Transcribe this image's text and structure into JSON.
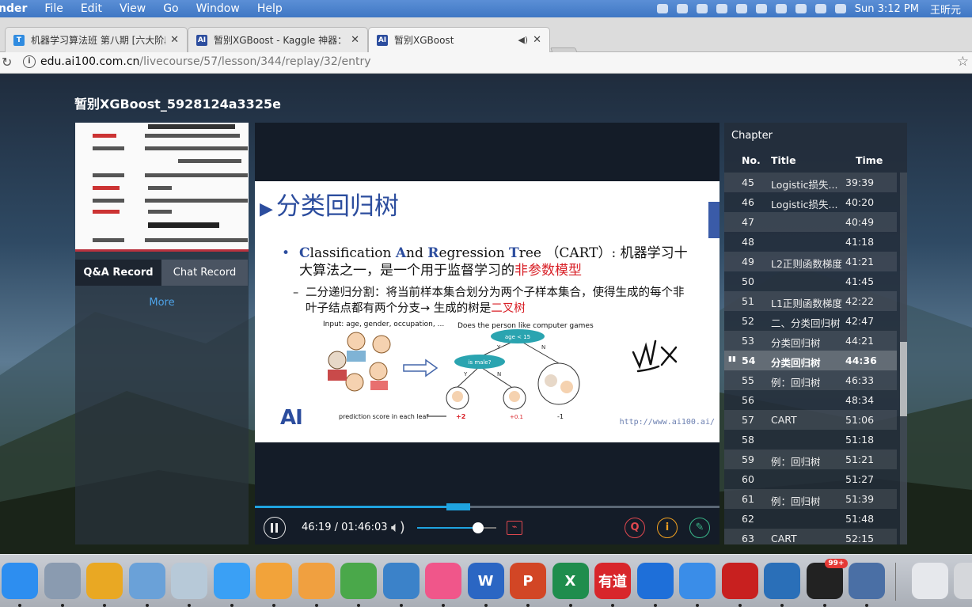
{
  "menubar": {
    "app": "nder",
    "items": [
      "File",
      "Edit",
      "View",
      "Go",
      "Window",
      "Help"
    ],
    "clock": "Sun 3:12 PM",
    "user": "王昕元"
  },
  "tabs": [
    {
      "label": "机器学习算法班 第八期 [六大阶段",
      "icon": "T"
    },
    {
      "label": "暂别XGBoost - Kaggle 神器：X",
      "icon": "AI"
    },
    {
      "label": "暂别XGBoost",
      "icon": "AI"
    }
  ],
  "address": {
    "host": "edu.ai100.com.cn",
    "path": "/livecourse/57/lesson/344/replay/32/entry"
  },
  "page_title": "暂别XGBoost_5928124a3325e",
  "left_panel": {
    "tab_qa": "Q&A Record",
    "tab_chat": "Chat Record",
    "more": "More"
  },
  "slide": {
    "title": "分类回归树",
    "bullet_c": "C",
    "bullet_lassification": "lassification ",
    "bullet_a": "A",
    "bullet_nd": "nd ",
    "bullet_r": "R",
    "bullet_egression": "egression ",
    "bullet_t": "T",
    "bullet_ree": "ree （CART）: 机器学习十大算法之一，是一个用于监督学习的",
    "bullet_red": "非参数模型",
    "sub_text": "二分递归分割：将当前样本集合划分为两个子样本集合，使得生成的每个非叶子结点都有两个分支→ 生成的树是",
    "sub_red": "二叉树",
    "diagram_input": "Input: age, gender, occupation, ...",
    "diagram_question": "Does the person like computer games",
    "node_age": "age < 15",
    "node_male": "is male?",
    "y1": "Y",
    "n1": "N",
    "y2": "Y",
    "n2": "N",
    "leaf_caption": "prediction score in each leaf",
    "score1": "+2",
    "score2": "+0.1",
    "score3": "-1",
    "logo": "AI",
    "footer_url": "http://www.ai100.ai/"
  },
  "player": {
    "time": "46:19 / 01:46:03",
    "progress": 0.437,
    "volume": 0.77,
    "btn_qa": "Q",
    "btn_info": "i"
  },
  "chapters": {
    "heading": "Chapter",
    "col_no": "No.",
    "col_title": "Title",
    "col_time": "Time",
    "current_marker": "▮▮",
    "rows": [
      {
        "no": "45",
        "title": "Logistic损失...",
        "time": "39:39"
      },
      {
        "no": "46",
        "title": "Logistic损失...",
        "time": "40:20"
      },
      {
        "no": "47",
        "title": "",
        "time": "40:49"
      },
      {
        "no": "48",
        "title": "",
        "time": "41:18"
      },
      {
        "no": "49",
        "title": "L2正则函数梯度",
        "time": "41:21"
      },
      {
        "no": "50",
        "title": "",
        "time": "41:45"
      },
      {
        "no": "51",
        "title": "L1正则函数梯度",
        "time": "42:22"
      },
      {
        "no": "52",
        "title": "二、分类回归树",
        "time": "42:47"
      },
      {
        "no": "53",
        "title": "分类回归树",
        "time": "44:21"
      },
      {
        "no": "54",
        "title": "分类回归树",
        "time": "44:36"
      },
      {
        "no": "55",
        "title": "例：回归树",
        "time": "46:33"
      },
      {
        "no": "56",
        "title": "",
        "time": "48:34"
      },
      {
        "no": "57",
        "title": "CART",
        "time": "51:06"
      },
      {
        "no": "58",
        "title": "",
        "time": "51:18"
      },
      {
        "no": "59",
        "title": "例：回归树",
        "time": "51:21"
      },
      {
        "no": "60",
        "title": "",
        "time": "51:27"
      },
      {
        "no": "61",
        "title": "例：回归树",
        "time": "51:39"
      },
      {
        "no": "62",
        "title": "",
        "time": "51:48"
      },
      {
        "no": "63",
        "title": "CART",
        "time": "52:15"
      }
    ]
  },
  "dock": {
    "apps": [
      {
        "name": "finder",
        "color": "#2d8ef0"
      },
      {
        "name": "launchpad",
        "color": "#8a9bb0"
      },
      {
        "name": "chrome",
        "color": "#e9a823"
      },
      {
        "name": "mail",
        "color": "#6aa1d8"
      },
      {
        "name": "preview",
        "color": "#b7c9d8"
      },
      {
        "name": "messages",
        "color": "#3aa0f5"
      },
      {
        "name": "photos",
        "color": "#f2a33a"
      },
      {
        "name": "pages",
        "color": "#f0a040"
      },
      {
        "name": "numbers",
        "color": "#4aa84a"
      },
      {
        "name": "keynote",
        "color": "#3b82c9"
      },
      {
        "name": "itunes",
        "color": "#f0568a"
      },
      {
        "name": "word",
        "color": "#2b66c3",
        "glyph": "W"
      },
      {
        "name": "powerpoint",
        "color": "#d24625",
        "glyph": "P"
      },
      {
        "name": "excel",
        "color": "#1f8d4d",
        "glyph": "X"
      },
      {
        "name": "youdao",
        "color": "#d8262b",
        "glyph": "有道"
      },
      {
        "name": "teamviewer",
        "color": "#1e6fd9"
      },
      {
        "name": "feishu",
        "color": "#3a8de8"
      },
      {
        "name": "acrobat",
        "color": "#c8201f"
      },
      {
        "name": "quicktime",
        "color": "#2a6fb8"
      },
      {
        "name": "qq",
        "color": "#222222",
        "badge": "99+"
      },
      {
        "name": "spotlight",
        "color": "#4a6fa5"
      },
      {
        "name": "downloads",
        "color": "#e6e8ec"
      },
      {
        "name": "trash",
        "color": "#d5d7db"
      }
    ]
  }
}
